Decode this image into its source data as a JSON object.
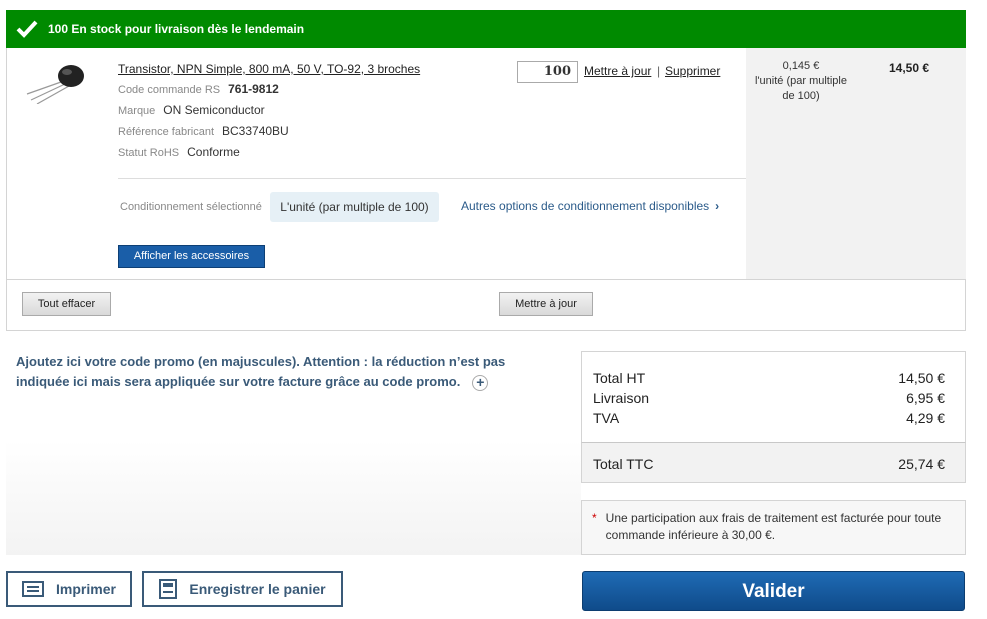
{
  "stock_banner": {
    "text": "100 En stock pour livraison dès le lendemain",
    "color": "#008a00"
  },
  "product": {
    "title": "Transistor, NPN Simple, 800 mA, 50 V, TO-92, 3 broches",
    "specs": [
      {
        "label": "Code commande RS",
        "value": "761-9812"
      },
      {
        "label": "Marque",
        "value": "ON Semiconductor"
      },
      {
        "label": "Référence fabricant",
        "value": "BC33740BU"
      },
      {
        "label": "Statut RoHS",
        "value": "Conforme"
      }
    ],
    "quantity": "100",
    "update_link": "Mettre à jour",
    "separator": "|",
    "delete_link": "Supprimer",
    "unit_price": "0,145 €",
    "unit_desc": "l'unité (par multiple de 100)",
    "line_total": "14,50 €",
    "packaging_label": "Conditionnement sélectionné",
    "packaging_value": "L'unité (par multiple de 100)",
    "packaging_more": "Autres options de conditionnement disponibles",
    "accessories_button": "Afficher les accessoires"
  },
  "actions": {
    "clear_all": "Tout effacer",
    "update": "Mettre à jour"
  },
  "promo": {
    "text": "Ajoutez ici votre code promo (en majuscules). Attention : la réduction n’est pas indiquée ici mais sera appliquée sur votre facture grâce au code promo."
  },
  "totals": {
    "rows": [
      {
        "label": "Total HT",
        "value": "14,50 €"
      },
      {
        "label": "Livraison",
        "value": "6,95 €"
      },
      {
        "label": "TVA",
        "value": "4,29 €"
      }
    ],
    "ttc_label": "Total TTC",
    "ttc_value": "25,74 €"
  },
  "note": {
    "asterisk": "*",
    "text": "Une participation aux frais de traitement est facturée pour toute commande inférieure à 30,00 €."
  },
  "footer": {
    "print": "Imprimer",
    "save_cart": "Enregistrer le panier",
    "validate": "Valider"
  }
}
